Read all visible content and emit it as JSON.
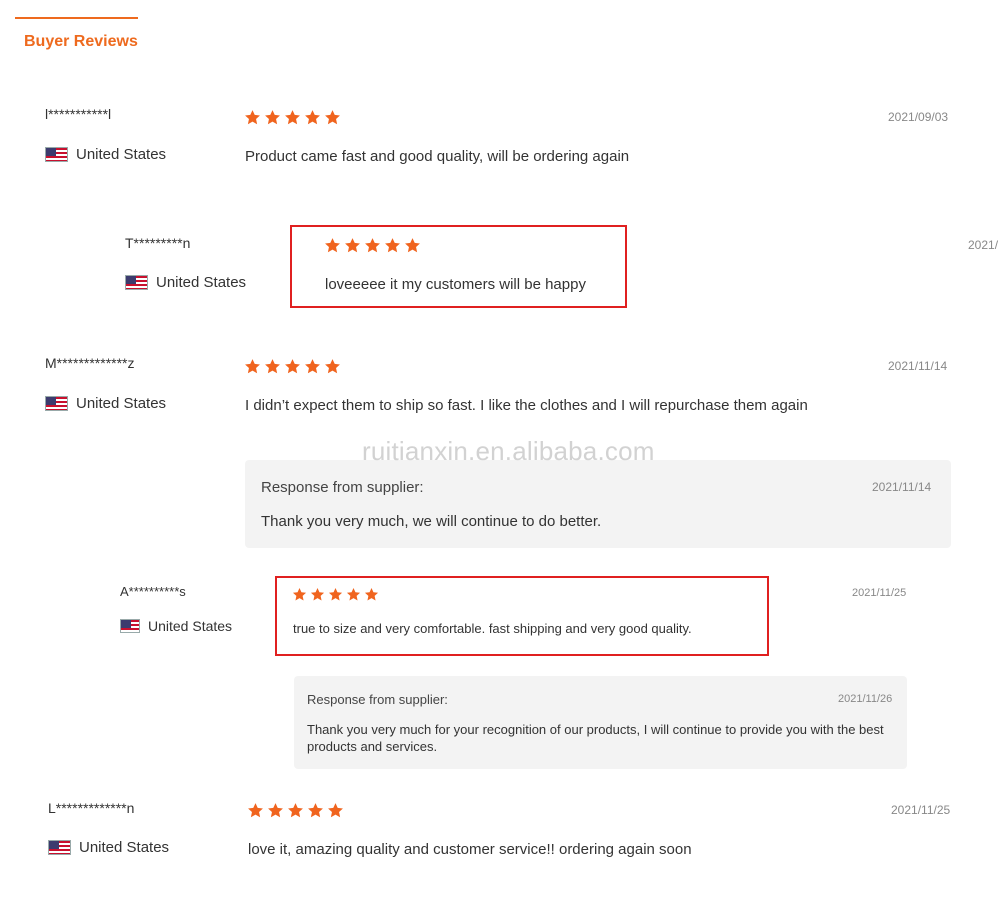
{
  "tab": {
    "label": "Buyer Reviews"
  },
  "watermark": "ruitianxin.en.alibaba.com",
  "reviews": [
    {
      "name": "l***********l",
      "country": "United States",
      "rating": 5,
      "date": "2021/09/03",
      "text": "Product came fast and good quality, will be ordering again"
    },
    {
      "name": "T*********n",
      "country": "United States",
      "rating": 5,
      "date": "2021/",
      "text": "loveeeee it my customers will be happy"
    },
    {
      "name": "M*************z",
      "country": "United States",
      "rating": 5,
      "date": "2021/11/14",
      "text": "I didn’t expect them to ship so fast. I like the clothes and I will repurchase them again",
      "response": {
        "label": "Response from supplier:",
        "date": "2021/11/14",
        "text": "Thank you very much, we will continue to do better."
      }
    },
    {
      "name": "A**********s",
      "country": "United States",
      "rating": 5,
      "date": "2021/11/25",
      "text": "true to size and very comfortable. fast shipping and very good quality.",
      "response": {
        "label": "Response from supplier:",
        "date": "2021/11/26",
        "text": "Thank you very much for your recognition of our products, I will continue to provide you with the best products and services."
      }
    },
    {
      "name": "L*************n",
      "country": "United States",
      "rating": 5,
      "date": "2021/11/25",
      "text": "love it, amazing quality and customer service!! ordering again soon"
    }
  ],
  "colors": {
    "accent": "#ee6a1e",
    "star": "#f0641e",
    "highlight": "#e02020",
    "response_bg": "#f3f3f3"
  }
}
